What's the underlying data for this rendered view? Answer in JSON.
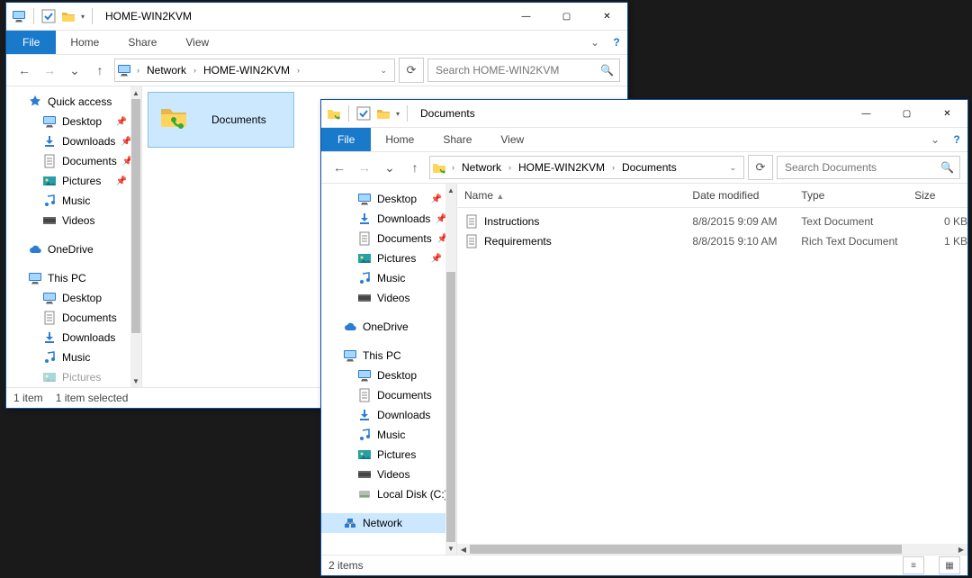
{
  "win1": {
    "title": "HOME-WIN2KVM",
    "tabs": {
      "file": "File",
      "home": "Home",
      "share": "Share",
      "view": "View"
    },
    "breadcrumb": [
      "Network",
      "HOME-WIN2KVM"
    ],
    "search_placeholder": "Search HOME-WIN2KVM",
    "nav": {
      "quick_access": "Quick access",
      "desktop": "Desktop",
      "downloads": "Downloads",
      "documents": "Documents",
      "pictures": "Pictures",
      "music": "Music",
      "videos": "Videos",
      "onedrive": "OneDrive",
      "this_pc": "This PC",
      "tp_desktop": "Desktop",
      "tp_documents": "Documents",
      "tp_downloads": "Downloads",
      "tp_music": "Music",
      "tp_pictures": "Pictures"
    },
    "folder_label": "Documents",
    "status": {
      "count": "1 item",
      "sel": "1 item selected"
    }
  },
  "win2": {
    "title": "Documents",
    "tabs": {
      "file": "File",
      "home": "Home",
      "share": "Share",
      "view": "View"
    },
    "breadcrumb": [
      "Network",
      "HOME-WIN2KVM",
      "Documents"
    ],
    "search_placeholder": "Search Documents",
    "columns": {
      "name": "Name",
      "date": "Date modified",
      "type": "Type",
      "size": "Size"
    },
    "files": [
      {
        "name": "Instructions",
        "date": "8/8/2015 9:09 AM",
        "type": "Text Document",
        "size": "0 KB"
      },
      {
        "name": "Requirements",
        "date": "8/8/2015 9:10 AM",
        "type": "Rich Text Document",
        "size": "1 KB"
      }
    ],
    "nav": {
      "desktop": "Desktop",
      "downloads": "Downloads",
      "documents": "Documents",
      "pictures": "Pictures",
      "music": "Music",
      "videos": "Videos",
      "onedrive": "OneDrive",
      "this_pc": "This PC",
      "tp_desktop": "Desktop",
      "tp_documents": "Documents",
      "tp_downloads": "Downloads",
      "tp_music": "Music",
      "tp_pictures": "Pictures",
      "tp_videos": "Videos",
      "tp_localdisk": "Local Disk (C:)",
      "network": "Network"
    },
    "status": {
      "count": "2 items"
    }
  }
}
